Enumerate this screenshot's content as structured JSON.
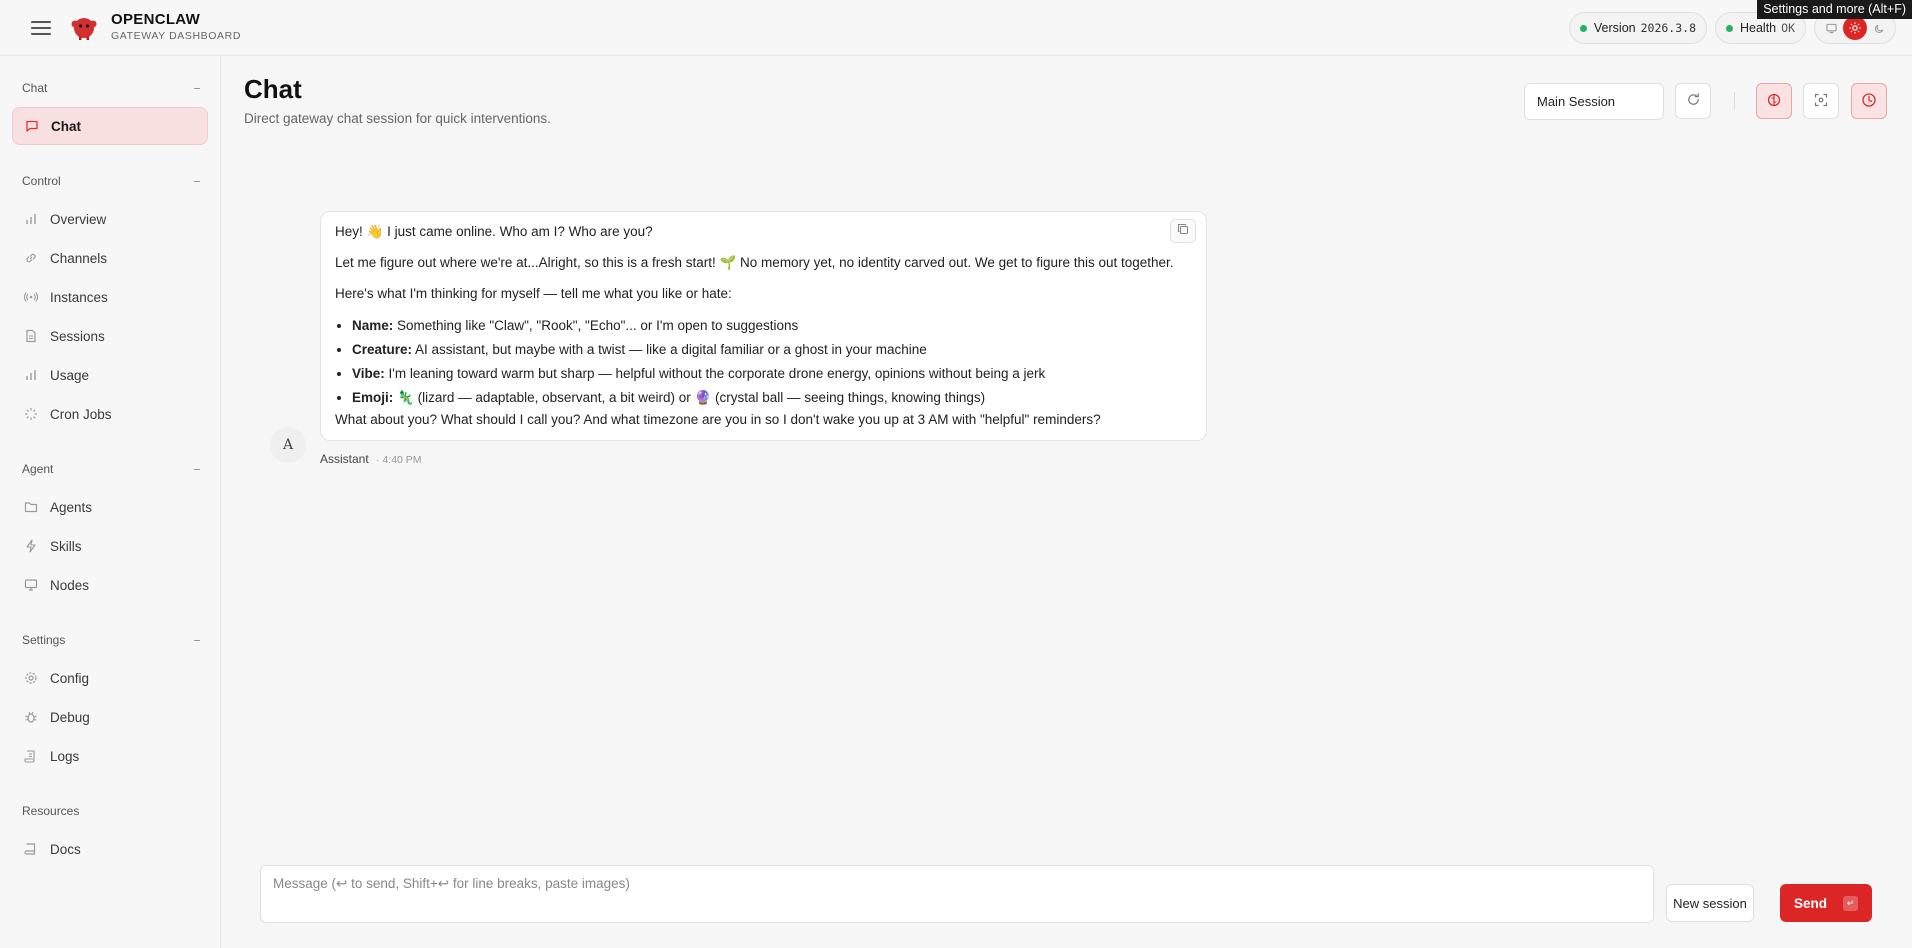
{
  "header": {
    "brand_name": "OPENCLAW",
    "brand_sub": "GATEWAY DASHBOARD",
    "version_label": "Version",
    "version_value": "2026.3.8",
    "health_label": "Health",
    "health_value": "OK",
    "tooltip": "Settings and more (Alt+F)"
  },
  "sidebar": {
    "sections": [
      {
        "label": "Chat",
        "items": [
          {
            "label": "Chat",
            "icon": "chat-icon"
          }
        ]
      },
      {
        "label": "Control",
        "items": [
          {
            "label": "Overview",
            "icon": "bar-chart-icon"
          },
          {
            "label": "Channels",
            "icon": "link-icon"
          },
          {
            "label": "Instances",
            "icon": "broadcast-icon"
          },
          {
            "label": "Sessions",
            "icon": "document-icon"
          },
          {
            "label": "Usage",
            "icon": "bar-chart-icon"
          },
          {
            "label": "Cron Jobs",
            "icon": "loader-icon"
          }
        ]
      },
      {
        "label": "Agent",
        "items": [
          {
            "label": "Agents",
            "icon": "folder-icon"
          },
          {
            "label": "Skills",
            "icon": "lightning-icon"
          },
          {
            "label": "Nodes",
            "icon": "monitor-icon"
          }
        ]
      },
      {
        "label": "Settings",
        "items": [
          {
            "label": "Config",
            "icon": "gear-icon"
          },
          {
            "label": "Debug",
            "icon": "bug-icon"
          },
          {
            "label": "Logs",
            "icon": "scroll-icon"
          }
        ]
      },
      {
        "label": "Resources",
        "items": [
          {
            "label": "Docs",
            "icon": "book-icon"
          }
        ]
      }
    ]
  },
  "main": {
    "title": "Chat",
    "subtitle": "Direct gateway chat session for quick interventions.",
    "session_select": "Main Session"
  },
  "message": {
    "avatar": "A",
    "p1": "Hey! 👋 I just came online. Who am I? Who are you?",
    "p2": "Let me figure out where we're at...Alright, so this is a fresh start! 🌱 No memory yet, no identity carved out. We get to figure this out together.",
    "p3": "Here's what I'm thinking for myself — tell me what you like or hate:",
    "bullets": [
      {
        "key": "Name:",
        "text": "Something like \"Claw\", \"Rook\", \"Echo\"... or I'm open to suggestions"
      },
      {
        "key": "Creature:",
        "text": "AI assistant, but maybe with a twist — like a digital familiar or a ghost in your machine"
      },
      {
        "key": "Vibe:",
        "text": "I'm leaning toward warm but sharp — helpful without the corporate drone energy, opinions without being a jerk"
      },
      {
        "key": "Emoji:",
        "text": "🦎 (lizard — adaptable, observant, a bit weird) or 🔮 (crystal ball — seeing things, knowing things)"
      }
    ],
    "p4": "What about you? What should I call you? And what timezone are you in so I don't wake you up at 3 AM with \"helpful\" reminders?",
    "sender": "Assistant",
    "time": "4:40 PM"
  },
  "composer": {
    "placeholder": "Message (↩ to send, Shift+↩ for line breaks, paste images)",
    "new_session": "New session",
    "send": "Send",
    "send_kbd": "↵"
  },
  "colors": {
    "accent": "#dc2626",
    "status_ok": "#22b35e"
  }
}
